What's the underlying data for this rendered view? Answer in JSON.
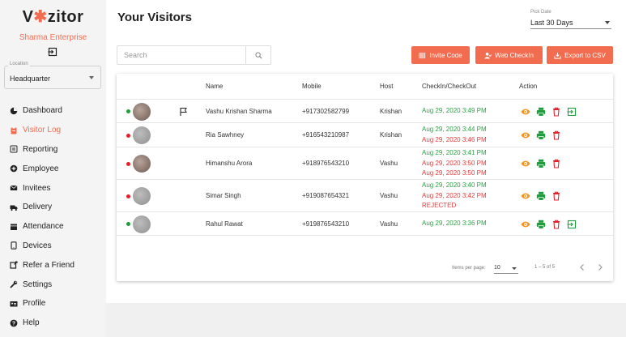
{
  "brand": {
    "logo_prefix": "V",
    "logo_mark": "✱",
    "logo_suffix": "zitor",
    "org_name": "Sharma Enterprise"
  },
  "location": {
    "label": "Location",
    "value": "Headquarter"
  },
  "nav": [
    {
      "label": "Dashboard",
      "icon": "pie-chart-icon",
      "active": false
    },
    {
      "label": "Visitor Log",
      "icon": "clipboard-icon",
      "active": true
    },
    {
      "label": "Reporting",
      "icon": "report-icon",
      "active": false
    },
    {
      "label": "Employee",
      "icon": "add-circle-icon",
      "active": false
    },
    {
      "label": "Invitees",
      "icon": "envelope-icon",
      "active": false
    },
    {
      "label": "Delivery",
      "icon": "truck-icon",
      "active": false
    },
    {
      "label": "Attendance",
      "icon": "calendar-icon",
      "active": false
    },
    {
      "label": "Devices",
      "icon": "tablet-icon",
      "active": false
    },
    {
      "label": "Refer a Friend",
      "icon": "share-icon",
      "active": false
    },
    {
      "label": "Settings",
      "icon": "wrench-icon",
      "active": false
    },
    {
      "label": "Profile",
      "icon": "id-card-icon",
      "active": false
    },
    {
      "label": "Help",
      "icon": "help-circle-icon",
      "active": false
    }
  ],
  "page": {
    "title": "Your Visitors"
  },
  "date_picker": {
    "label": "Pick Date",
    "value": "Last 30 Days"
  },
  "search": {
    "placeholder": "Search"
  },
  "toolbar": {
    "invite_code": "Invite Code",
    "web_checkin": "Web CheckIn",
    "export_csv": "Export to CSV"
  },
  "table": {
    "headers": {
      "name": "Name",
      "mobile": "Mobile",
      "host": "Host",
      "checkin": "CheckIn/CheckOut",
      "action": "Action"
    },
    "rows": [
      {
        "status": "green",
        "name": "Vashu Krishan Sharma",
        "mobile": "+917302582799",
        "host": "Krishan",
        "flag": true,
        "checkin": "Aug 29, 2020 3:49 PM",
        "checkouts": [],
        "rejected": "",
        "checkout_icon": true
      },
      {
        "status": "red",
        "name": "Ria Sawhney",
        "mobile": "+916543210987",
        "host": "Krishan",
        "flag": false,
        "checkin": "Aug 29, 2020 3:44 PM",
        "checkouts": [
          "Aug 29, 2020 3:46 PM"
        ],
        "rejected": "",
        "checkout_icon": false
      },
      {
        "status": "red",
        "name": "Himanshu Arora",
        "mobile": "+918976543210",
        "host": "Vashu",
        "flag": false,
        "checkin": "Aug 29, 2020 3:41 PM",
        "checkouts": [
          "Aug 29, 2020 3:50 PM",
          "Aug 29, 2020 3:50 PM"
        ],
        "rejected": "",
        "checkout_icon": false
      },
      {
        "status": "red",
        "name": "Simar Singh",
        "mobile": "+919087654321",
        "host": "Vashu",
        "flag": false,
        "checkin": "Aug 29, 2020 3:40 PM",
        "checkouts": [
          "Aug 29, 2020 3:42 PM"
        ],
        "rejected": "REJECTED",
        "checkout_icon": false
      },
      {
        "status": "green",
        "name": "Rahul Rawat",
        "mobile": "+919876543210",
        "host": "Vashu",
        "flag": false,
        "checkin": "Aug 29, 2020 3:36 PM",
        "checkouts": [],
        "rejected": "",
        "checkout_icon": true
      }
    ]
  },
  "paginator": {
    "label": "Items per page:",
    "page_size": "10",
    "range": "1 – 5 of 5"
  },
  "colors": {
    "accent": "#f26c4f",
    "checkin": "#2e9e45",
    "checkout": "#e03b3b",
    "status_green": "#1e9e3a",
    "status_red": "#e8202a",
    "view_icon": "#f7931e",
    "print_icon": "#1e9e3a",
    "delete_icon": "#e8202a",
    "checkout_icon": "#1e9e3a"
  }
}
